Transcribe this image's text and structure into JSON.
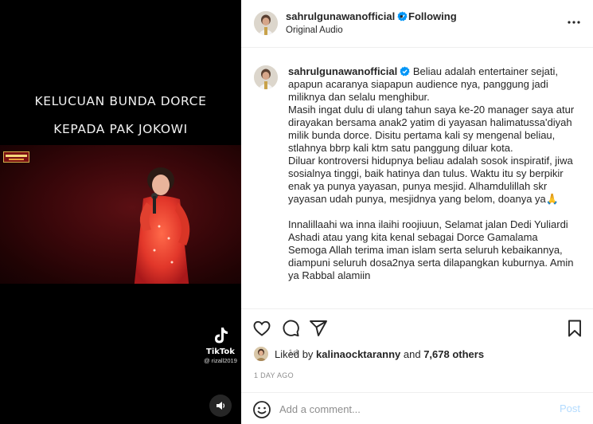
{
  "media": {
    "overlay_line1": "KELUCUAN BUNDA DORCE",
    "overlay_line2": "KEPADA PAK JOKOWI",
    "stage_logo_text": "JAKARTA ... ",
    "tiktok_label": "TikTok",
    "tiktok_user": "@ rizall2019",
    "sound_icon": "speaker-icon"
  },
  "header": {
    "username": "sahrulgunawanofficial",
    "dot": "•",
    "following_label": "Following",
    "audio_label": "Original Audio",
    "more_icon": "more-horizontal-icon"
  },
  "post": {
    "username": "sahrulgunawanofficial",
    "caption_body": " Beliau adalah entertainer sejati, apapun acaranya siapapun audience nya, panggung jadi miliknya dan selalu menghibur.\nMasih ingat dulu di ulang tahun saya ke-20 manager saya atur dirayakan bersama anak2 yatim di yayasan halimatussa'diyah milik bunda dorce. Disitu pertama kali sy mengenal beliau, stlahnya bbrp kali ktm satu panggung diluar kota.\nDiluar kontroversi hidupnya beliau adalah sosok inspiratif, jiwa sosialnya tinggi, baik hatinya dan tulus. Waktu itu sy berpikir enak ya punya yayasan, punya mesjid. Alhamdulillah skr yayasan udah punya, mesjidnya yang belom, doanya ya🙏\n\nInnalillaahi wa inna ilaihi roojiuun, Selamat jalan Dedi Yuliardi Ashadi atau yang kita kenal sebagai Dorce Gamalama\nSemoga Allah terima iman islam serta seluruh kebaikannya, diampuni seluruh dosa2nya serta dilapangkan kuburnya. Amin ya Rabbal alamiin",
    "time_ago": "1d"
  },
  "actions": {
    "like_icon": "heart-icon",
    "comment_icon": "comment-icon",
    "share_icon": "paper-plane-icon",
    "save_icon": "bookmark-icon"
  },
  "likes": {
    "prefix": "Liked by ",
    "user": "kalinaocktaranny",
    "middle": " and ",
    "count": "7,678 others"
  },
  "date_label": "1 DAY AGO",
  "comment": {
    "placeholder": "Add a comment...",
    "post_label": "Post",
    "emoji_icon": "smiley-icon"
  },
  "colors": {
    "verified_blue": "#0095f6",
    "post_disabled": "#b3dbff",
    "muted": "#8e8e8e"
  }
}
